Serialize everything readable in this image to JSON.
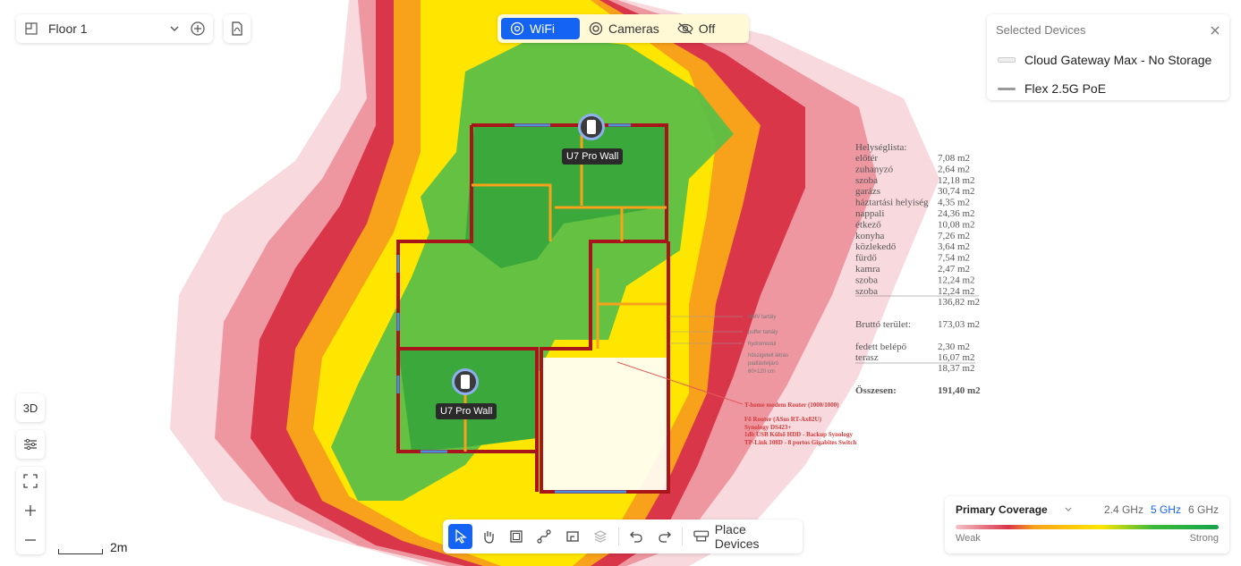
{
  "floor": {
    "selected": "Floor 1"
  },
  "mode_bar": {
    "wifi_label": "WiFi",
    "cameras_label": "Cameras",
    "off_label": "Off",
    "active": "WiFi"
  },
  "selected_devices": {
    "title": "Selected Devices",
    "items": [
      {
        "name": "Cloud Gateway Max - No Storage"
      },
      {
        "name": "Flex 2.5G PoE"
      }
    ]
  },
  "access_points": [
    {
      "label": "U7 Pro Wall"
    },
    {
      "label": "U7 Pro Wall"
    }
  ],
  "left_controls": {
    "view_3d_label": "3D"
  },
  "scale": {
    "label": "2m"
  },
  "toolbar": {
    "place_devices_label": "Place Devices"
  },
  "coverage": {
    "title": "Primary Coverage",
    "bands": [
      "2.4 GHz",
      "5 GHz",
      "6 GHz"
    ],
    "selected_band": "5 GHz",
    "weak_label": "Weak",
    "strong_label": "Strong"
  },
  "floorplan_text": {
    "room_list_title": "Helységlista:",
    "rooms": [
      {
        "name": "előtér",
        "area": "7,08 m2"
      },
      {
        "name": "zuhanyzó",
        "area": "2,64 m2"
      },
      {
        "name": "szoba",
        "area": "12,18 m2"
      },
      {
        "name": "garázs",
        "area": "30,74 m2"
      },
      {
        "name": "háztartási helyiség",
        "area": "4,35 m2"
      },
      {
        "name": "nappali",
        "area": "24,36 m2"
      },
      {
        "name": "étkező",
        "area": "10,08 m2"
      },
      {
        "name": "konyha",
        "area": "7,26 m2"
      },
      {
        "name": "közlekedő",
        "area": "3,64 m2"
      },
      {
        "name": "fürdő",
        "area": "7,54 m2"
      },
      {
        "name": "kamra",
        "area": "2,47 m2"
      },
      {
        "name": "szoba",
        "area": "12,24 m2"
      },
      {
        "name": "szoba",
        "area": "12,24 m2"
      }
    ],
    "subtotal": "136,82 m2",
    "gross_label": "Bruttó terület:",
    "gross_value": "173,03 m2",
    "covered_label": "fedett belépő",
    "covered_value": "2,30 m2",
    "terrace_label": "terasz",
    "terrace_value": "16,07 m2",
    "outdoor_sum": "18,37 m2",
    "total_label": "Összesen:",
    "total_value": "191,40 m2",
    "router_note": "T-home modem Router (1000/1000)",
    "equipment": [
      "Fő Router (ASus RT-Ax82U)",
      "Synology DS423+",
      "1db USB Külső HDD - Backup Synology",
      "TP-Link 108D - 8 portos Gigabites Switch"
    ],
    "labels_right": [
      "HMV tartály",
      "puffer tartály",
      "hydromodul",
      "hőszigetelt létrás",
      "padlásfeljáró",
      "60×120 cm"
    ]
  }
}
